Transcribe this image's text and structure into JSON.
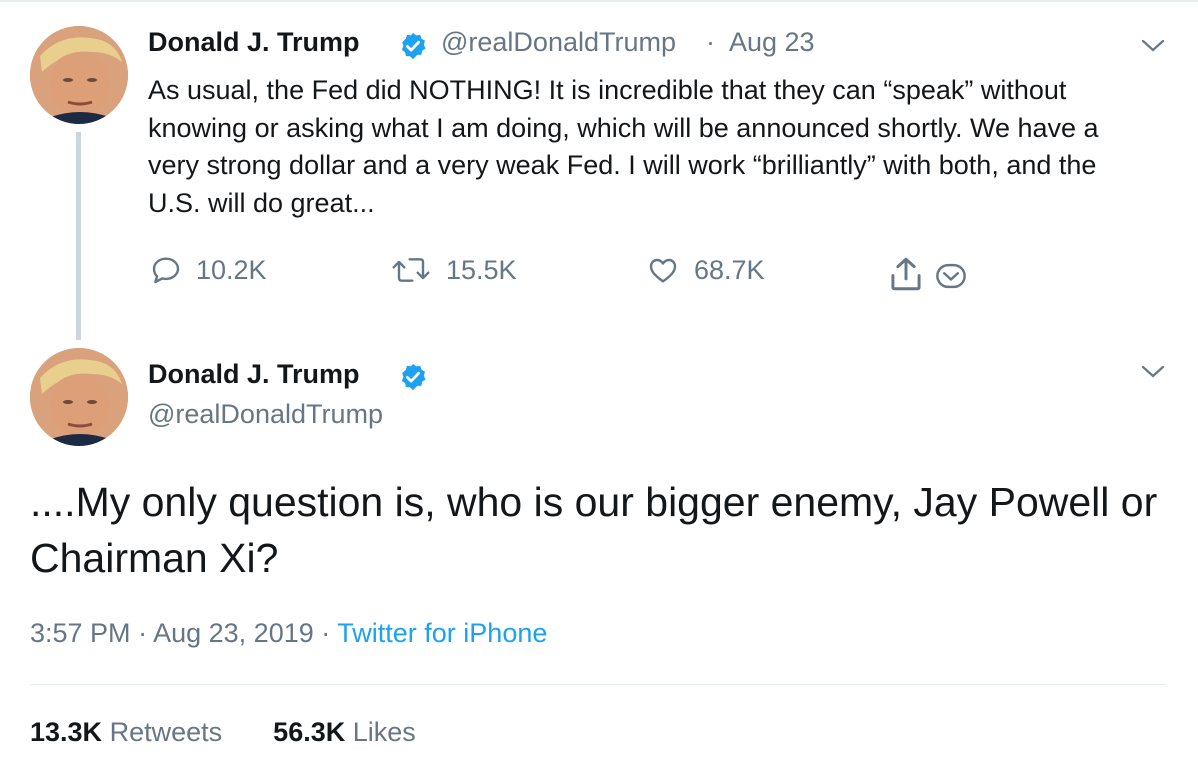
{
  "tweet1": {
    "author_name": "Donald J. Trump",
    "handle": "@realDonaldTrump",
    "separator": "·",
    "date": "Aug 23",
    "text": "As usual, the Fed did NOTHING! It is incredible that they can “speak” without knowing or asking what I am doing, which will be announced shortly. We have a very strong dollar and a very weak Fed. I will work “brilliantly” with both, and the U.S. will do great...",
    "replies": "10.2K",
    "retweets": "15.5K",
    "likes": "68.7K"
  },
  "tweet2": {
    "author_name": "Donald J. Trump",
    "handle": "@realDonaldTrump",
    "text": "....My only question is, who is our bigger enemy, Jay Powell or Chairman Xi?",
    "time": "3:57 PM",
    "sep": "·",
    "date": "Aug 23, 2019",
    "source": "Twitter for iPhone",
    "retweet_count": "13.3K",
    "retweet_label": "Retweets",
    "like_count": "56.3K",
    "like_label": "Likes"
  },
  "colors": {
    "text": "#14171a",
    "secondary": "#657786",
    "accent": "#1da1f2",
    "thread_line": "#ccd6dd"
  },
  "icons": {
    "reply": "reply-icon",
    "retweet": "retweet-icon",
    "like": "heart-icon",
    "share": "share-icon",
    "dm": "direct-message-icon",
    "verified": "verified-badge-icon",
    "caret": "chevron-down-icon"
  }
}
